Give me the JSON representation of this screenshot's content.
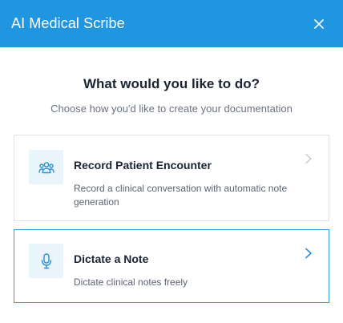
{
  "header": {
    "title": "AI Medical Scribe",
    "close_icon": "close-icon"
  },
  "main": {
    "heading": "What would you like to do?",
    "subheading": "Choose how you'd like to create your documentation",
    "options": [
      {
        "title": "Record Patient Encounter",
        "description": "Record a clinical conversation with automatic note generation",
        "icon": "people-group-icon",
        "selected": false
      },
      {
        "title": "Dictate a Note",
        "description": "Dictate clinical notes freely",
        "icon": "microphone-icon",
        "selected": true
      }
    ]
  },
  "colors": {
    "header_bg": "#2196e0",
    "accent": "#3a9ed8",
    "icon_bg": "#eaf4fb"
  }
}
